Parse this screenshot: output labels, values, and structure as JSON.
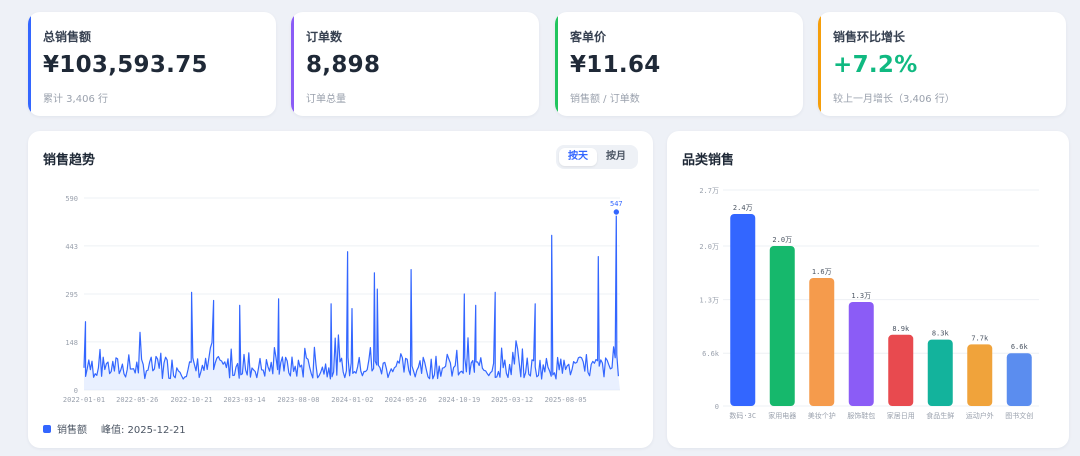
{
  "kpis": [
    {
      "label": "总销售额",
      "value": "¥103,593.75",
      "sub": "累计 3,406 行",
      "accent": "#3366ff",
      "value_color": "#1f2937"
    },
    {
      "label": "订单数",
      "value": "8,898",
      "sub": "订单总量",
      "accent": "#8b5cf6",
      "value_color": "#1f2937"
    },
    {
      "label": "客单价",
      "value": "¥11.64",
      "sub": "销售额 / 订单数",
      "accent": "#22c55e",
      "value_color": "#1f2937"
    },
    {
      "label": "销售环比增长",
      "value": "+7.2%",
      "sub": "较上一月增长（3,406 行）",
      "accent": "#f59e0b",
      "value_color": "#10b981"
    }
  ],
  "trend": {
    "title": "销售趋势",
    "toggle": {
      "day": "按天",
      "month": "按月",
      "active": "day"
    },
    "legend_label": "销售额",
    "peak_label": "峰值: 2025-12-21",
    "peak_value_label": "547"
  },
  "category": {
    "title": "品类销售"
  },
  "chart_data": [
    {
      "type": "line",
      "xlabel": "",
      "ylabel": "",
      "y_ticks": [
        "0",
        "148",
        "295",
        "443",
        "590"
      ],
      "ylim": [
        0,
        590
      ],
      "x_ticks": [
        "2022-01-01",
        "2022-05-26",
        "2022-10-21",
        "2023-03-14",
        "2023-08-08",
        "2024-01-02",
        "2024-05-26",
        "2024-10-19",
        "2025-03-12",
        "2025-08-05"
      ],
      "xlim": [
        "2022-01-01",
        "2025-12-31"
      ],
      "series": [
        {
          "name": "销售额",
          "color": "#3366ff",
          "daily_baseline": 75,
          "daily_spread": 70
        }
      ],
      "spikes": [
        {
          "x": "2022-01-05",
          "y": 210
        },
        {
          "x": "2022-10-21",
          "y": 300
        },
        {
          "x": "2022-12-20",
          "y": 275
        },
        {
          "x": "2023-03-01",
          "y": 260
        },
        {
          "x": "2023-06-15",
          "y": 280
        },
        {
          "x": "2023-11-05",
          "y": 265
        },
        {
          "x": "2023-12-20",
          "y": 425
        },
        {
          "x": "2024-01-01",
          "y": 250
        },
        {
          "x": "2024-03-02",
          "y": 360
        },
        {
          "x": "2024-03-10",
          "y": 310
        },
        {
          "x": "2024-06-10",
          "y": 370
        },
        {
          "x": "2024-11-02",
          "y": 295
        },
        {
          "x": "2024-12-03",
          "y": 260
        },
        {
          "x": "2025-01-25",
          "y": 300
        },
        {
          "x": "2025-05-14",
          "y": 265
        },
        {
          "x": "2025-06-28",
          "y": 475
        },
        {
          "x": "2025-11-02",
          "y": 410
        },
        {
          "x": "2025-12-21",
          "y": 547
        }
      ],
      "grid": true,
      "legend": "bottom-left"
    },
    {
      "type": "bar",
      "categories": [
        "数码·3C",
        "家用电器",
        "美妆个护",
        "服饰鞋包",
        "家居日用",
        "食品生鲜",
        "运动户外",
        "图书文创"
      ],
      "values": [
        24000,
        20000,
        16000,
        13000,
        8900,
        8300,
        7700,
        6600
      ],
      "data_labels": [
        "2.4万",
        "2.0万",
        "1.6万",
        "1.3万",
        "8.9k",
        "8.3k",
        "7.7k",
        "6.6k"
      ],
      "colors": [
        "#3366ff",
        "#16b86c",
        "#f59b4c",
        "#8b5cf6",
        "#e84a4f",
        "#13b39c",
        "#f0a33b",
        "#5b8def"
      ],
      "y_ticks": [
        "0",
        "6.6k",
        "1.3万",
        "2.0万",
        "2.7万"
      ],
      "ylim": [
        0,
        27000
      ],
      "grid": true
    }
  ]
}
